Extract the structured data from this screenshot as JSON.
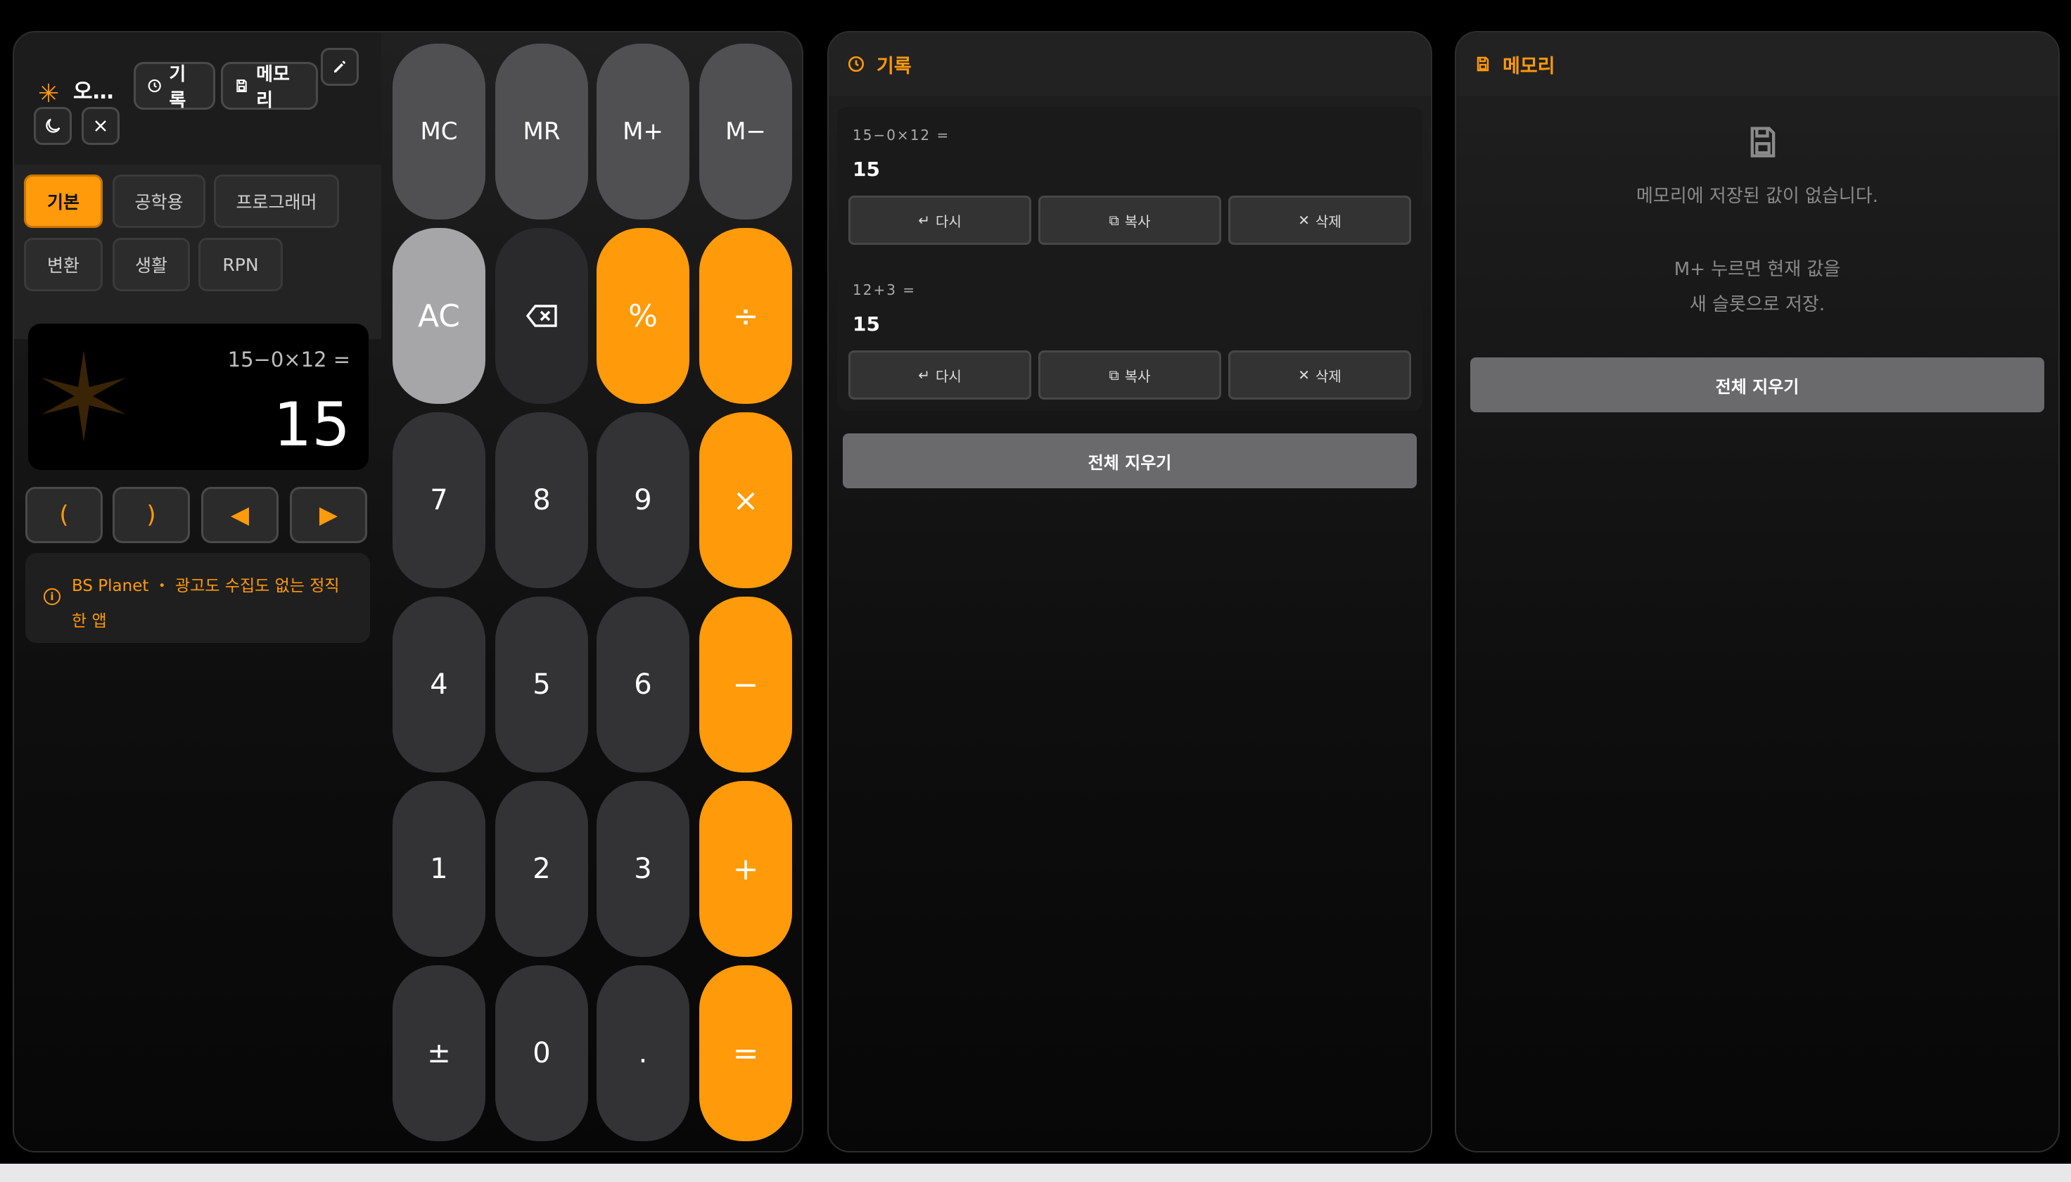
{
  "app": {
    "name": "오…",
    "tagline": "BS Planet ・ 광고도 수집도 없는 정직한 앱"
  },
  "toolbar": {
    "history_label": "기록",
    "memory_label": "메모리"
  },
  "modes": [
    "기본",
    "공학용",
    "프로그래머",
    "변환",
    "생활",
    "RPN"
  ],
  "active_mode": "기본",
  "display": {
    "expression": "15−0×12 =",
    "result": "15"
  },
  "nav": {
    "open_paren": "(",
    "close_paren": ")",
    "left": "◀",
    "right": "▶"
  },
  "keys": {
    "mc": "MC",
    "mr": "MR",
    "mplus": "M+",
    "mminus": "M−",
    "ac": "AC",
    "percent": "%",
    "divide": "÷",
    "k7": "7",
    "k8": "8",
    "k9": "9",
    "multiply": "×",
    "k4": "4",
    "k5": "5",
    "k6": "6",
    "minus": "−",
    "k1": "1",
    "k2": "2",
    "k3": "3",
    "plus": "+",
    "sign": "±",
    "k0": "0",
    "dot": ".",
    "equals": "="
  },
  "history": {
    "title": "기록",
    "entries": [
      {
        "expression": "15−0×12  =",
        "value": "15",
        "redo": "다시",
        "copy": "복사",
        "delete": "삭제"
      },
      {
        "expression": "12+3  =",
        "value": "15",
        "redo": "다시",
        "copy": "복사",
        "delete": "삭제"
      }
    ],
    "clear_all": "전체 지우기"
  },
  "memory": {
    "title": "메모리",
    "empty_line1": "메모리에 저장된 값이 없습니다.",
    "hint_line1": "M+ 누르면 현재 값을",
    "hint_line2": "새 슬롯으로 저장.",
    "clear_all": "전체 지우기"
  },
  "colors": {
    "accent": "#ff9a0a",
    "background": "#000000",
    "key": "#333335",
    "memory_key": "#505052",
    "ac_key": "#a6a6a8"
  }
}
